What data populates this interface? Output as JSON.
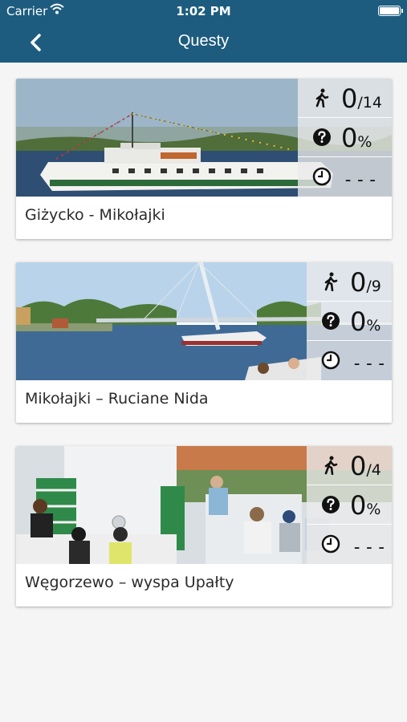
{
  "status_bar": {
    "carrier": "Carrier",
    "time": "1:02 PM"
  },
  "nav": {
    "title": "Questy"
  },
  "quests": [
    {
      "name": "Giżycko - Mikołajki",
      "steps_done": "0",
      "steps_total": "/14",
      "percent_value": "0",
      "percent_sign": "%",
      "time": "---"
    },
    {
      "name": "Mikołajki – Ruciane Nida",
      "steps_done": "0",
      "steps_total": "/9",
      "percent_value": "0",
      "percent_sign": "%",
      "time": "---"
    },
    {
      "name": "Węgorzewo – wyspa Upałty",
      "steps_done": "0",
      "steps_total": "/4",
      "percent_value": "0",
      "percent_sign": "%",
      "time": "---"
    }
  ],
  "colors": {
    "header": "#1d5c7e",
    "background": "#f5f5f5"
  }
}
